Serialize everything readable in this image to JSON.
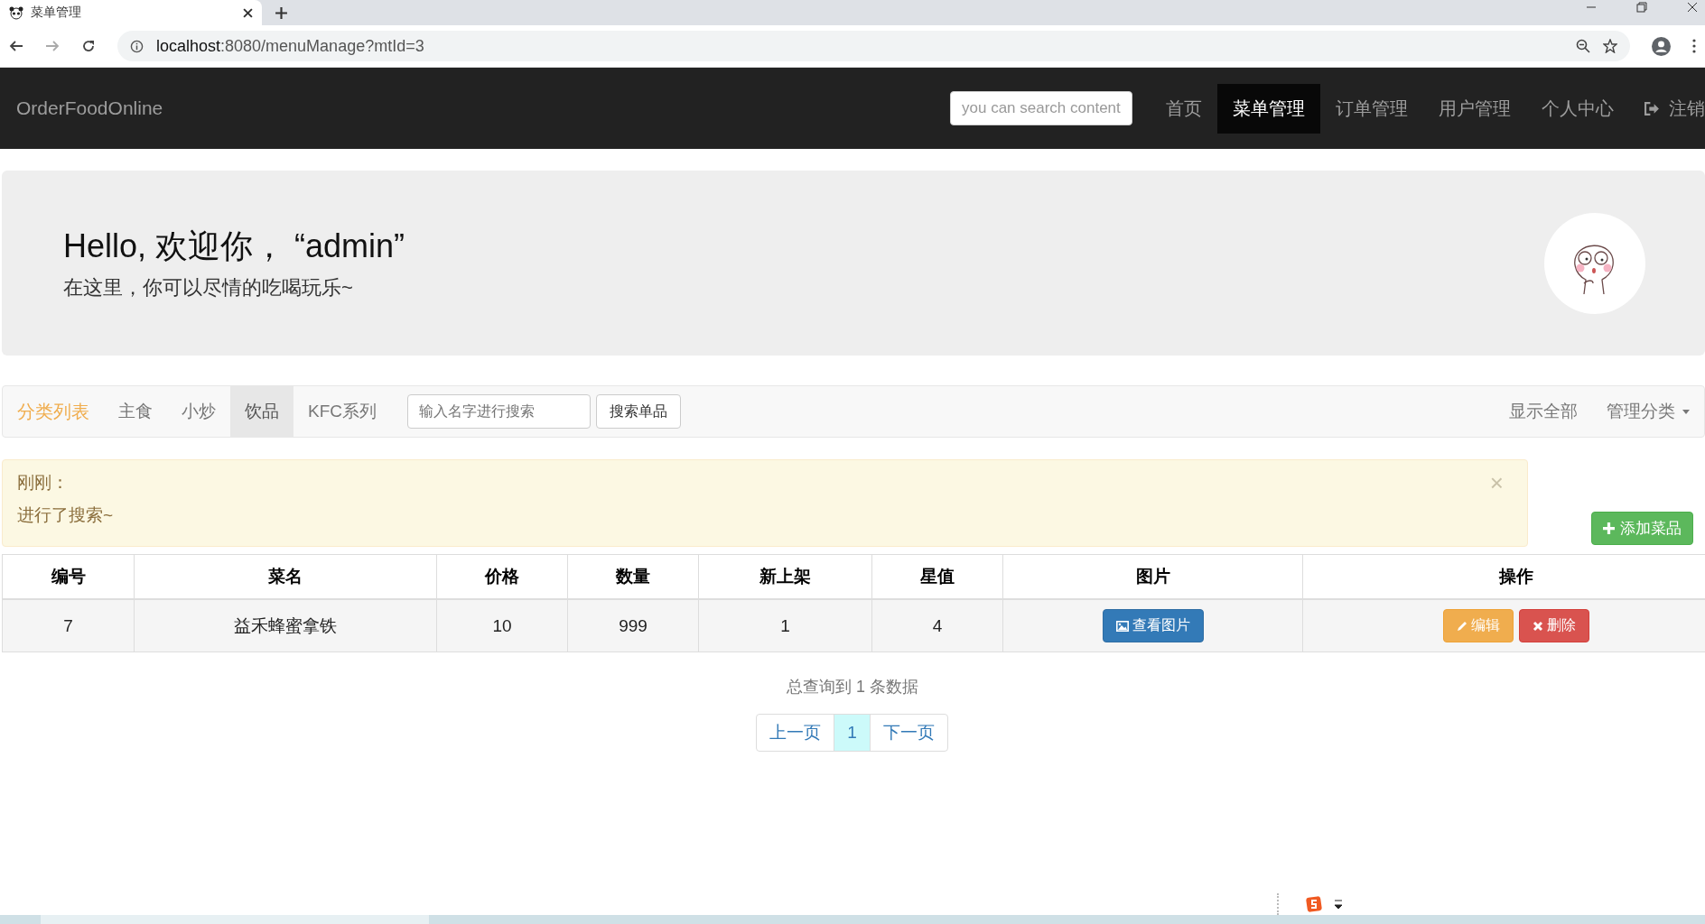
{
  "browser": {
    "tab_title": "菜单管理",
    "url_host": "localhost",
    "url_rest": ":8080/menuManage?mtId=3"
  },
  "navbar": {
    "brand": "OrderFoodOnline",
    "search": {
      "placeholder": "you can search content"
    },
    "items": [
      {
        "label": "首页",
        "selected": false
      },
      {
        "label": "菜单管理",
        "selected": true
      },
      {
        "label": "订单管理",
        "selected": false
      },
      {
        "label": "用户管理",
        "selected": false
      },
      {
        "label": "个人中心",
        "selected": false
      }
    ],
    "logout": "注销"
  },
  "jumbotron": {
    "greeting": "Hello, 欢迎你，  “admin”",
    "subtitle": "在这里，你可以尽情的吃喝玩乐~"
  },
  "category_bar": {
    "title": "分类列表",
    "categories": [
      {
        "label": "主食",
        "selected": false
      },
      {
        "label": "小炒",
        "selected": false
      },
      {
        "label": "饮品",
        "selected": true
      },
      {
        "label": "KFC系列",
        "selected": false
      }
    ],
    "search": {
      "placeholder": "输入名字进行搜索"
    },
    "search_button": "搜索单品",
    "show_all": "显示全部",
    "manage": "管理分类"
  },
  "alert": {
    "title": "刚刚：",
    "message": "进行了搜索~",
    "close": "×"
  },
  "add_button": "添加菜品",
  "table": {
    "columns": [
      "编号",
      "菜名",
      "价格",
      "数量",
      "新上架",
      "星值",
      "图片",
      "操作"
    ],
    "rows": [
      {
        "id": "7",
        "name": "益禾蜂蜜拿铁",
        "price": "10",
        "quantity": "999",
        "new": "1",
        "stars_value": "4",
        "view_button": "查看图片",
        "edit_button": "编辑",
        "delete_button": "删除"
      }
    ]
  },
  "summary": "总查询到 1 条数据",
  "pagination": {
    "prev": "上一页",
    "pages": [
      {
        "label": "1",
        "selected": true
      }
    ],
    "next": "下一页"
  }
}
